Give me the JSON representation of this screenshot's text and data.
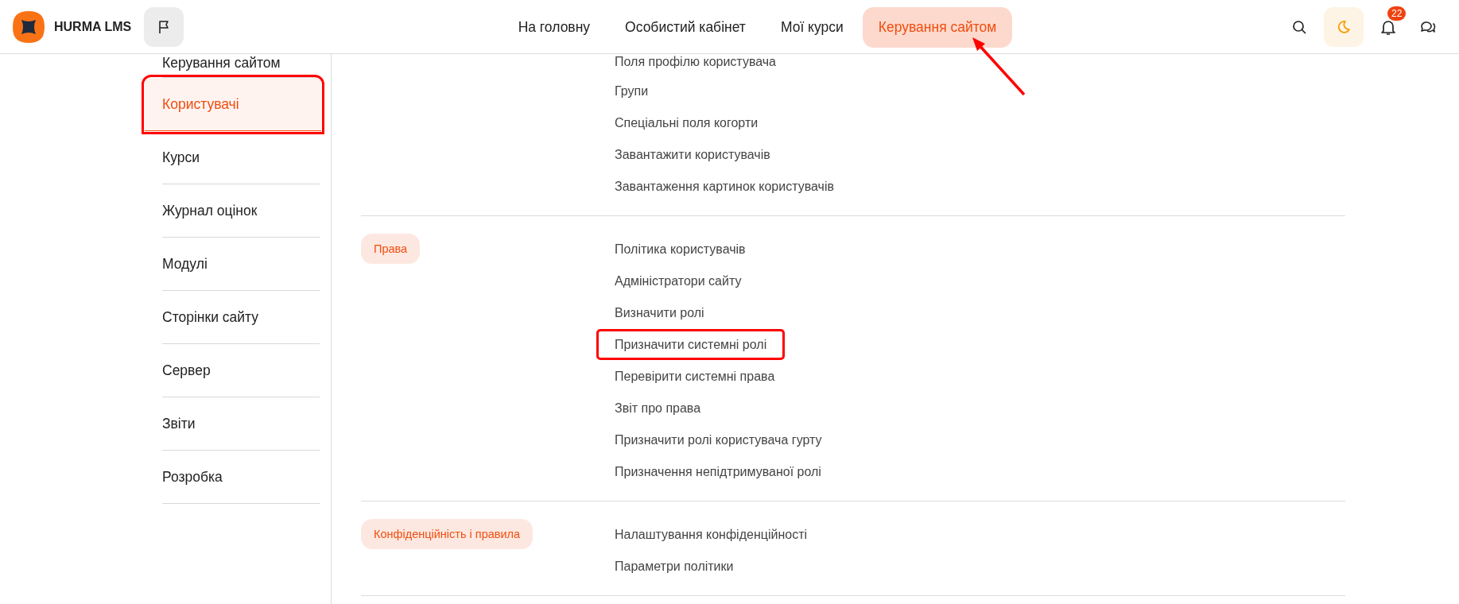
{
  "header": {
    "brand": "HURMA LMS",
    "nav": [
      {
        "label": "На головну",
        "selected": false
      },
      {
        "label": "Особистий кабінет",
        "selected": false
      },
      {
        "label": "Мої курси",
        "selected": false
      },
      {
        "label": "Керування сайтом",
        "selected": true
      }
    ],
    "notifications": "22"
  },
  "sidebar": {
    "items": [
      {
        "label": "Керування сайтом",
        "selected": false,
        "highlighted": false
      },
      {
        "label": "Користувачі",
        "selected": true,
        "highlighted": true
      },
      {
        "label": "Курси",
        "selected": false,
        "highlighted": false
      },
      {
        "label": "Журнал оцінок",
        "selected": false,
        "highlighted": false
      },
      {
        "label": "Модулі",
        "selected": false,
        "highlighted": false
      },
      {
        "label": "Сторінки сайту",
        "selected": false,
        "highlighted": false
      },
      {
        "label": "Сервер",
        "selected": false,
        "highlighted": false
      },
      {
        "label": "Звіти",
        "selected": false,
        "highlighted": false
      },
      {
        "label": "Розробка",
        "selected": false,
        "highlighted": false
      }
    ]
  },
  "sections": [
    {
      "links": [
        {
          "label": "Поля профілю користувача",
          "highlighted": false
        },
        {
          "label": "Групи",
          "highlighted": false
        },
        {
          "label": "Спеціальні поля когорти",
          "highlighted": false
        },
        {
          "label": "Завантажити користувачів",
          "highlighted": false
        },
        {
          "label": "Завантаження картинок користувачів",
          "highlighted": false
        }
      ]
    },
    {
      "tag": "Права",
      "links": [
        {
          "label": "Політика користувачів",
          "highlighted": false
        },
        {
          "label": "Адміністратори сайту",
          "highlighted": false
        },
        {
          "label": "Визначити ролі",
          "highlighted": false
        },
        {
          "label": "Призначити системні ролі",
          "highlighted": true
        },
        {
          "label": "Перевірити системні права",
          "highlighted": false
        },
        {
          "label": "Звіт про права",
          "highlighted": false
        },
        {
          "label": "Призначити ролі користувача гурту",
          "highlighted": false
        },
        {
          "label": "Призначення непідтримуваної ролі",
          "highlighted": false
        }
      ]
    },
    {
      "tag": "Конфіденційність і правила",
      "links": [
        {
          "label": "Налаштування конфіденційності",
          "highlighted": false
        },
        {
          "label": "Параметри політики",
          "highlighted": false
        }
      ]
    }
  ]
}
